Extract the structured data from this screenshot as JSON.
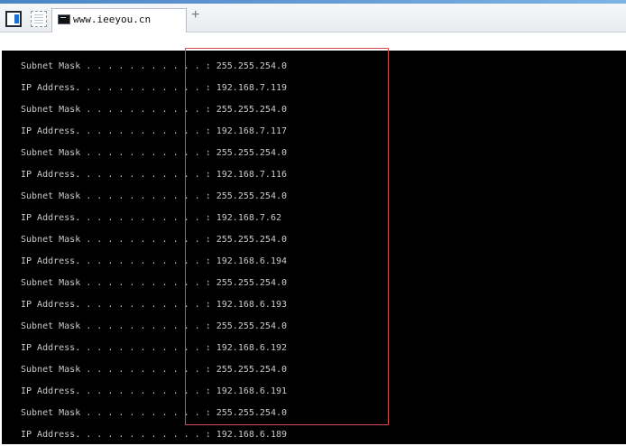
{
  "toolbar": {
    "tab_title": "www.ieeyou.cn",
    "icons": [
      "window-panel-icon",
      "grid-view-icon",
      "terminal-icon",
      "add-tab-icon"
    ],
    "plus_label": "+"
  },
  "console": {
    "lines": [
      "Subnet Mask . . . . . . . . . . . : 255.255.254.0",
      "IP Address. . . . . . . . . . . . : 192.168.7.119",
      "Subnet Mask . . . . . . . . . . . : 255.255.254.0",
      "IP Address. . . . . . . . . . . . : 192.168.7.117",
      "Subnet Mask . . . . . . . . . . . : 255.255.254.0",
      "IP Address. . . . . . . . . . . . : 192.168.7.116",
      "Subnet Mask . . . . . . . . . . . : 255.255.254.0",
      "IP Address. . . . . . . . . . . . : 192.168.7.62",
      "Subnet Mask . . . . . . . . . . . : 255.255.254.0",
      "IP Address. . . . . . . . . . . . : 192.168.6.194",
      "Subnet Mask . . . . . . . . . . . : 255.255.254.0",
      "IP Address. . . . . . . . . . . . : 192.168.6.193",
      "Subnet Mask . . . . . . . . . . . : 255.255.254.0",
      "IP Address. . . . . . . . . . . . : 192.168.6.192",
      "Subnet Mask . . . . . . . . . . . : 255.255.254.0",
      "IP Address. . . . . . . . . . . . : 192.168.6.191",
      "Subnet Mask . . . . . . . . . . . : 255.255.254.0",
      "IP Address. . . . . . . . . . . . : 192.168.6.189"
    ]
  },
  "colors": {
    "console_background": "#000000",
    "console_text": "#c9c9c9",
    "highlight_border": "#d94b4b"
  }
}
